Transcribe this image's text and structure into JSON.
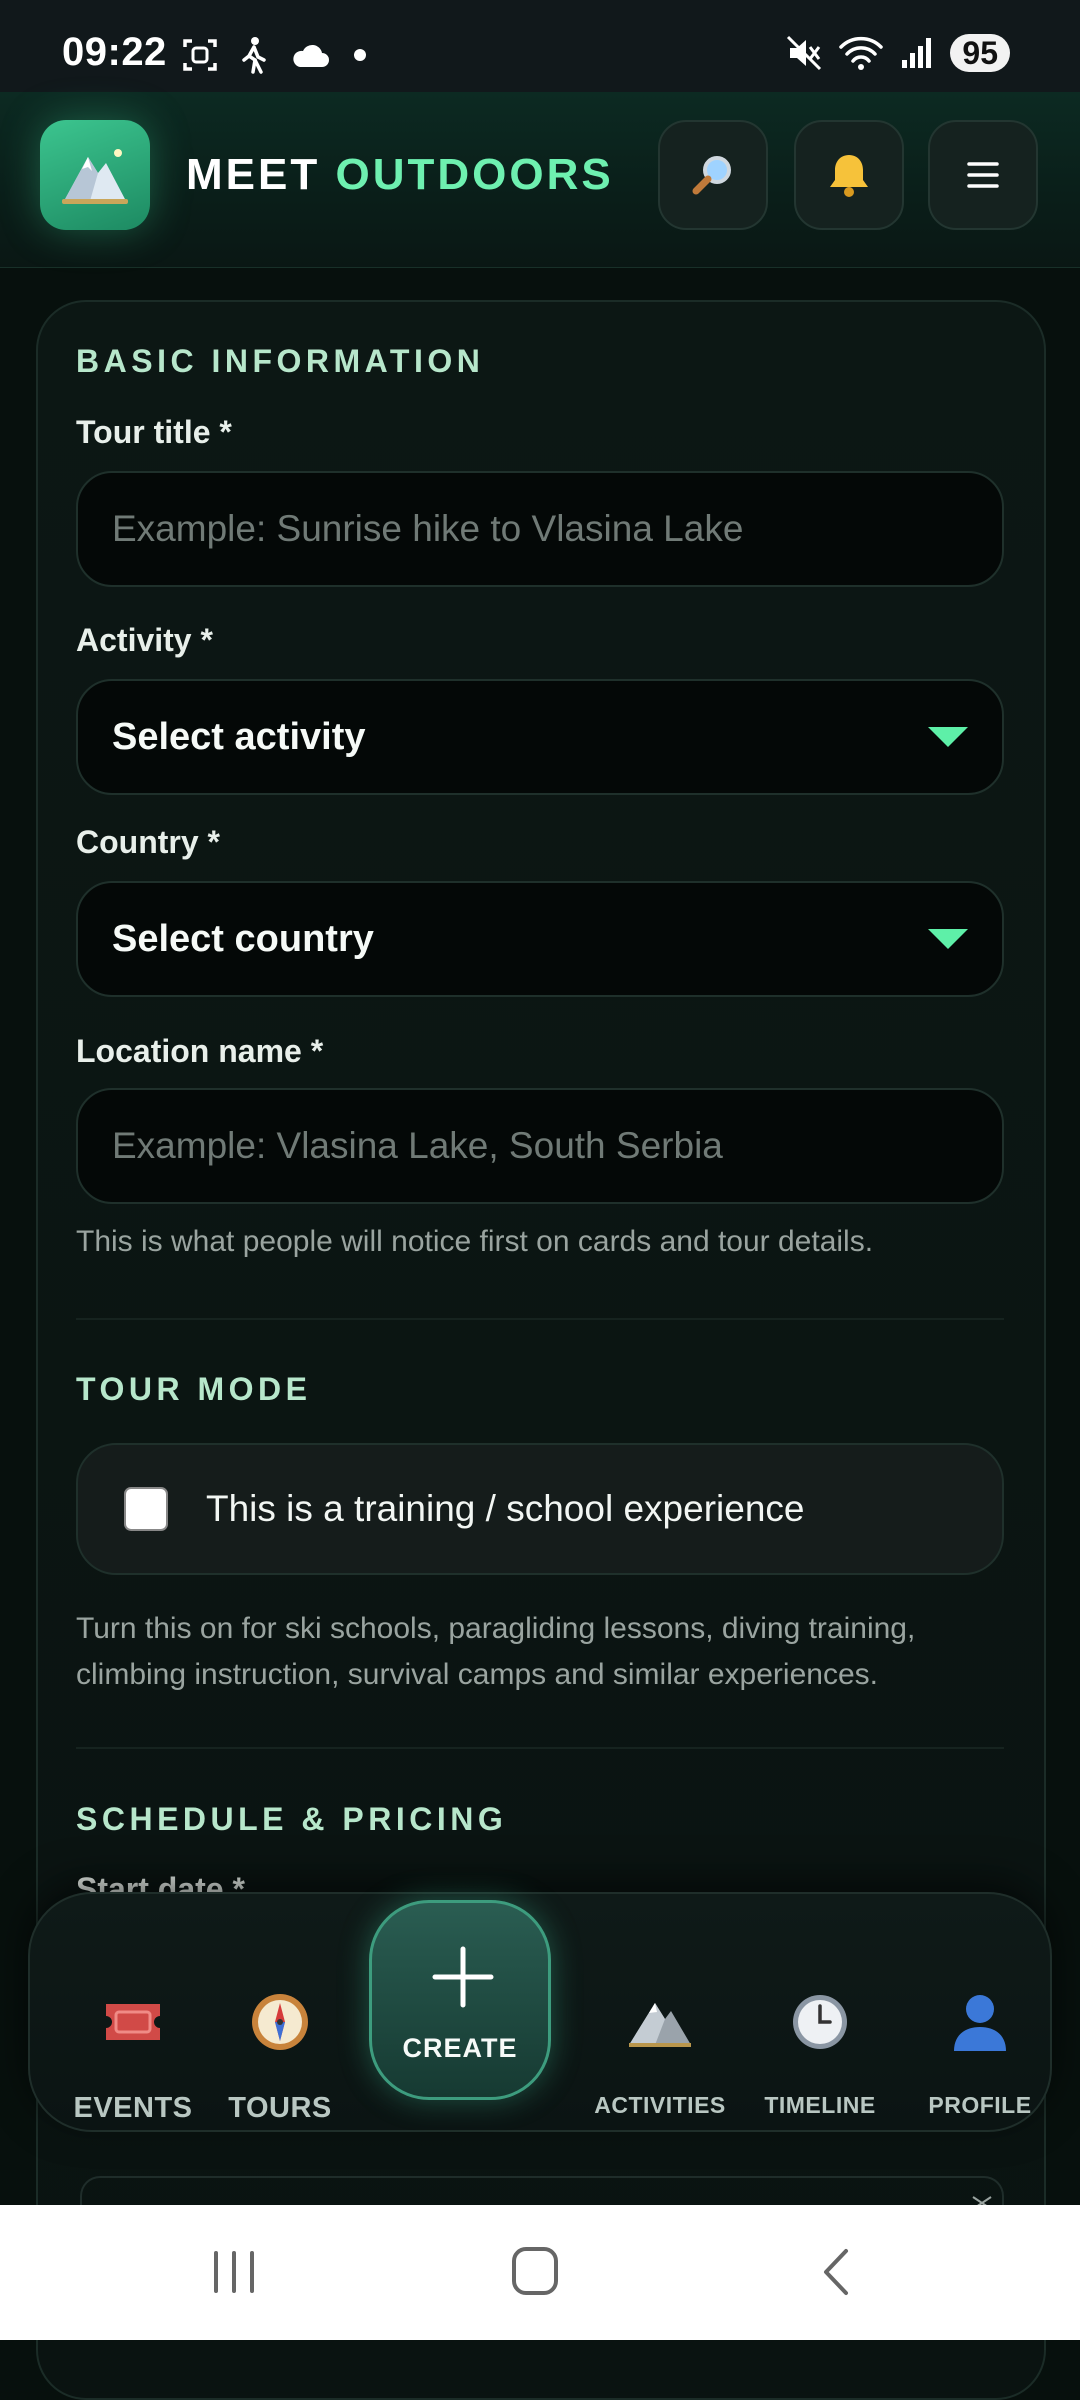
{
  "status_bar": {
    "time": "09:22",
    "battery": "95"
  },
  "header": {
    "brand_word1": "MEET",
    "brand_word2": "OUTDOORS"
  },
  "basic": {
    "section_title": "BASIC INFORMATION",
    "tour_title_label": "Tour title *",
    "tour_title_placeholder": "Example: Sunrise hike to Vlasina Lake",
    "activity_label": "Activity *",
    "activity_value": "Select activity",
    "country_label": "Country *",
    "country_value": "Select country",
    "location_label": "Location name *",
    "location_placeholder": "Example: Vlasina Lake, South Serbia",
    "helper": "This is what people will notice first on cards and tour details."
  },
  "tour_mode": {
    "section_title": "TOUR MODE",
    "checkbox_label": "This is a training / school experience",
    "helper": "Turn this on for ski schools, paragliding lessons, diving training, climbing instruction, survival camps and similar experiences."
  },
  "schedule": {
    "section_title": "SCHEDULE & PRICING",
    "start_date_label": "Start date *"
  },
  "nav": {
    "events": "EVENTS",
    "tours": "TOURS",
    "create": "CREATE",
    "activities": "ACTIVITIES",
    "timeline": "TIMELINE",
    "profile": "PROFILE"
  },
  "colors": {
    "accent": "#6ef0b0",
    "background": "#07100d"
  }
}
